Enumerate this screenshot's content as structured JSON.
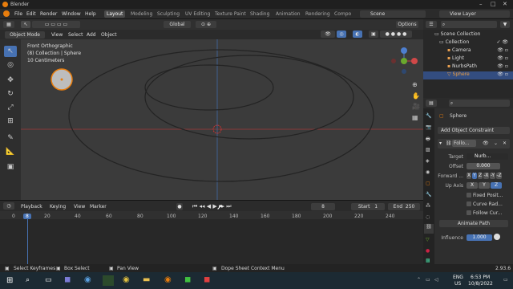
{
  "window": {
    "title": "Blender"
  },
  "menus": [
    "File",
    "Edit",
    "Render",
    "Window",
    "Help"
  ],
  "workspaces": [
    "Layout",
    "Modeling",
    "Sculpting",
    "UV Editing",
    "Texture Paint",
    "Shading",
    "Animation",
    "Rendering",
    "Compo"
  ],
  "active_workspace": "Layout",
  "scene": "Scene",
  "view_layer": "View Layer",
  "header3d": {
    "transform_orientation": "Global",
    "options": "Options"
  },
  "header3d_menu": {
    "mode": "Object Mode",
    "view": "View",
    "select": "Select",
    "add": "Add",
    "object": "Object"
  },
  "viewport": {
    "line1": "Front Orthographic",
    "line2": "(8) Collection | Sphere",
    "line3": "10 Centimeters",
    "gizmo": {
      "x": "X",
      "y": "Y",
      "z": "Z"
    }
  },
  "timeline_menu": {
    "playback": "Playback",
    "keying": "Keying",
    "view": "View",
    "marker": "Marker"
  },
  "timeline": {
    "current_frame": "8",
    "start_label": "Start",
    "start": "1",
    "end_label": "End",
    "end": "250",
    "ticks": [
      "0",
      "8",
      "20",
      "40",
      "60",
      "80",
      "100",
      "120",
      "140",
      "160",
      "180",
      "200",
      "220",
      "240"
    ]
  },
  "outliner": {
    "rows": [
      {
        "name": "Scene Collection"
      },
      {
        "name": "Collection"
      },
      {
        "name": "Camera"
      },
      {
        "name": "Light"
      },
      {
        "name": "NurbsPath"
      },
      {
        "name": "Sphere"
      }
    ]
  },
  "properties": {
    "object_name": "Sphere",
    "add_constraint": "Add Object Constraint",
    "constraint_name": "Follo...",
    "target_label": "Target",
    "target_value": "Nurb...",
    "offset_label": "Offset",
    "offset_value": "0.000",
    "forward_label": "Forward ...",
    "forward_opts": [
      "X",
      "Y",
      "Z",
      "-X",
      "-Y",
      "-Z"
    ],
    "up_label": "Up Axis",
    "up_opts": [
      "X",
      "Y",
      "Z"
    ],
    "fixed_pos": "Fixed Posit...",
    "curve_rad": "Curve Rad...",
    "follow_curve": "Follow Cur...",
    "animate_path": "Animate Path",
    "influence_label": "Influence",
    "influence_value": "1.000"
  },
  "status": {
    "select_keyframes": "Select Keyframes",
    "box_select": "Box Select",
    "pan_view": "Pan View",
    "context_menu": "Dope Sheet Context Menu",
    "version": "2.93.6"
  },
  "taskbar": {
    "lang1": "ENG",
    "lang2": "US",
    "time": "6:53 PM",
    "date": "10/8/2022"
  },
  "colors": {
    "accent": "#4772b3",
    "selected_orange": "#e87d0d",
    "axis_red": "#b84040",
    "axis_green": "#6aa82d"
  }
}
